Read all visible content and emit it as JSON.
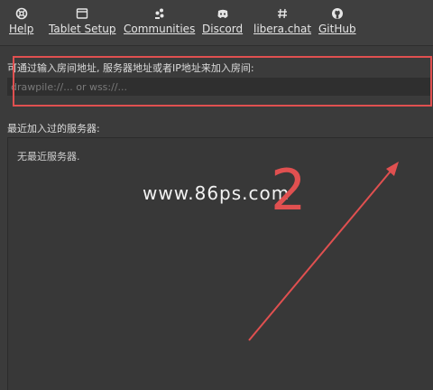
{
  "toolbar": {
    "items": [
      {
        "label": "Help",
        "icon": "help-icon"
      },
      {
        "label": "Tablet Setup",
        "icon": "tablet-icon"
      },
      {
        "label": "Communities",
        "icon": "communities-icon"
      },
      {
        "label": "Discord",
        "icon": "discord-icon"
      },
      {
        "label": "libera.chat",
        "icon": "hash-icon"
      },
      {
        "label": "GitHub",
        "icon": "github-icon"
      }
    ]
  },
  "join": {
    "label": "可通过输入房间地址, 服务器地址或者IP地址来加入房间:",
    "placeholder": "drawpile://... or wss://..."
  },
  "recent": {
    "label": "最近加入过的服务器:",
    "empty_text": "无最近服务器."
  },
  "overlay": {
    "watermark": "www.86ps.com",
    "step_number": "2",
    "accent_color": "#e05050"
  }
}
